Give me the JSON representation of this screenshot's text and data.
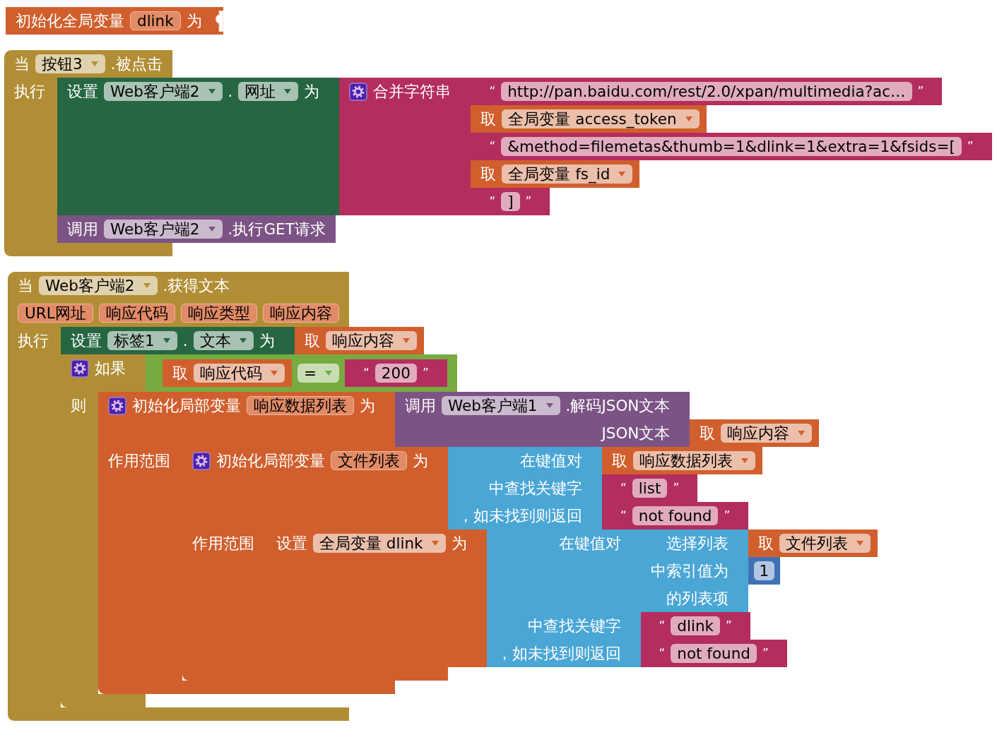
{
  "blocks": [
    {
      "kind": "global_init",
      "inputs": [
        {
          "kind": "value",
          "fields": [
            {
              "kind": "label",
              "text": "初始化全局变量"
            },
            {
              "kind": "name",
              "text": "dlink"
            },
            {
              "kind": "label",
              "text": "为"
            }
          ]
        }
      ]
    },
    {
      "kind": "event",
      "inputs": [
        {
          "kind": "dummy",
          "fields": [
            {
              "kind": "label",
              "text": "当"
            },
            {
              "kind": "dropdown",
              "text": "按钮3"
            },
            {
              "kind": "label",
              "text": ".被点击"
            }
          ]
        },
        {
          "kind": "statement",
          "fields": [
            {
              "kind": "label",
              "text": "执行"
            }
          ],
          "blocks": [
            {
              "kind": "component_setter",
              "inputs": [
                {
                  "kind": "value",
                  "fields": [
                    {
                      "kind": "label",
                      "text": "设置"
                    },
                    {
                      "kind": "dropdown",
                      "text": "Web客户端2"
                    },
                    {
                      "kind": "label",
                      "text": "."
                    },
                    {
                      "kind": "dropdown",
                      "text": "网址"
                    },
                    {
                      "kind": "label",
                      "text": "为"
                    }
                  ],
                  "block": {
                    "kind": "join",
                    "inputs": [
                      {
                        "kind": "value",
                        "fields": [
                          {
                            "kind": "mutator"
                          },
                          {
                            "kind": "label",
                            "text": "合并字符串"
                          }
                        ],
                        "block": {
                          "kind": "text",
                          "inputs": [
                            {
                              "kind": "dummy",
                              "fields": [
                                {
                                  "kind": "quote",
                                  "text": "“"
                                },
                                {
                                  "kind": "text",
                                  "text": "http://pan.baidu.com/rest/2.0/xpan/multimedia?ac…"
                                },
                                {
                                  "kind": "quote",
                                  "text": "”"
                                }
                              ]
                            }
                          ]
                        }
                      },
                      {
                        "kind": "value",
                        "block": {
                          "kind": "getter",
                          "inputs": [
                            {
                              "kind": "dummy",
                              "fields": [
                                {
                                  "kind": "label",
                                  "text": "取"
                                },
                                {
                                  "kind": "dropdown",
                                  "text": "全局变量 access_token"
                                }
                              ]
                            }
                          ]
                        }
                      },
                      {
                        "kind": "value",
                        "block": {
                          "kind": "text",
                          "inputs": [
                            {
                              "kind": "dummy",
                              "fields": [
                                {
                                  "kind": "quote",
                                  "text": "“"
                                },
                                {
                                  "kind": "text",
                                  "text": "&method=filemetas&thumb=1&dlink=1&extra=1&fsids=["
                                },
                                {
                                  "kind": "quote",
                                  "text": "”"
                                }
                              ]
                            }
                          ]
                        }
                      },
                      {
                        "kind": "value",
                        "block": {
                          "kind": "getter",
                          "inputs": [
                            {
                              "kind": "dummy",
                              "fields": [
                                {
                                  "kind": "label",
                                  "text": "取"
                                },
                                {
                                  "kind": "dropdown",
                                  "text": "全局变量 fs_id"
                                }
                              ]
                            }
                          ]
                        }
                      },
                      {
                        "kind": "value",
                        "block": {
                          "kind": "text",
                          "inputs": [
                            {
                              "kind": "dummy",
                              "fields": [
                                {
                                  "kind": "quote",
                                  "text": "“"
                                },
                                {
                                  "kind": "text",
                                  "text": "]"
                                },
                                {
                                  "kind": "quote",
                                  "text": "”"
                                }
                              ]
                            }
                          ]
                        }
                      }
                    ]
                  }
                }
              ]
            },
            {
              "kind": "method_call",
              "inputs": [
                {
                  "kind": "dummy",
                  "fields": [
                    {
                      "kind": "label",
                      "text": "调用"
                    },
                    {
                      "kind": "dropdown",
                      "text": "Web客户端2"
                    },
                    {
                      "kind": "label",
                      "text": ".执行GET请求"
                    }
                  ]
                }
              ]
            }
          ]
        }
      ]
    },
    {
      "kind": "event",
      "inputs": [
        {
          "kind": "dummy",
          "fields": [
            {
              "kind": "label",
              "text": "当"
            },
            {
              "kind": "dropdown",
              "text": "Web客户端2"
            },
            {
              "kind": "label",
              "text": ".获得文本"
            }
          ]
        },
        {
          "kind": "dummy",
          "fields": [
            {
              "kind": "name",
              "text": "URL网址"
            },
            {
              "kind": "name",
              "text": "响应代码"
            },
            {
              "kind": "name",
              "text": "响应类型"
            },
            {
              "kind": "name",
              "text": "响应内容"
            }
          ]
        },
        {
          "kind": "statement",
          "fields": [
            {
              "kind": "label",
              "text": "执行"
            }
          ],
          "blocks": [
            {
              "kind": "component_setter",
              "inputs": [
                {
                  "kind": "value",
                  "fields": [
                    {
                      "kind": "label",
                      "text": "设置"
                    },
                    {
                      "kind": "dropdown",
                      "text": "标签1"
                    },
                    {
                      "kind": "label",
                      "text": "."
                    },
                    {
                      "kind": "dropdown",
                      "text": "文本"
                    },
                    {
                      "kind": "label",
                      "text": "为"
                    }
                  ],
                  "block": {
                    "kind": "getter",
                    "inputs": [
                      {
                        "kind": "dummy",
                        "fields": [
                          {
                            "kind": "label",
                            "text": "取"
                          },
                          {
                            "kind": "dropdown",
                            "text": "响应内容"
                          }
                        ]
                      }
                    ]
                  }
                }
              ]
            },
            {
              "kind": "if",
              "inputs": [
                {
                  "kind": "value",
                  "fields": [
                    {
                      "kind": "mutator"
                    },
                    {
                      "kind": "label",
                      "text": "如果"
                    }
                  ],
                  "block": {
                    "kind": "compare",
                    "inputs": [
                      {
                        "kind": "value",
                        "block": {
                          "kind": "getter",
                          "inputs": [
                            {
                              "kind": "dummy",
                              "fields": [
                                {
                                  "kind": "label",
                                  "text": "取"
                                },
                                {
                                  "kind": "dropdown",
                                  "text": "响应代码"
                                }
                              ]
                            }
                          ]
                        }
                      },
                      {
                        "kind": "value",
                        "fields": [
                          {
                            "kind": "dropdown",
                            "text": "="
                          }
                        ],
                        "block": {
                          "kind": "text",
                          "inputs": [
                            {
                              "kind": "dummy",
                              "fields": [
                                {
                                  "kind": "quote",
                                  "text": "“"
                                },
                                {
                                  "kind": "text",
                                  "text": "200"
                                },
                                {
                                  "kind": "quote",
                                  "text": "”"
                                }
                              ]
                            }
                          ]
                        }
                      }
                    ]
                  }
                },
                {
                  "kind": "statement",
                  "fields": [
                    {
                      "kind": "label",
                      "text": "则"
                    }
                  ],
                  "blocks": [
                    {
                      "kind": "local_init",
                      "inputs": [
                        {
                          "kind": "value",
                          "fields": [
                            {
                              "kind": "mutator"
                            },
                            {
                              "kind": "label",
                              "text": "初始化局部变量"
                            },
                            {
                              "kind": "name",
                              "text": "响应数据列表"
                            },
                            {
                              "kind": "label",
                              "text": "为"
                            }
                          ],
                          "block": {
                            "kind": "method_call",
                            "inputs": [
                              {
                                "kind": "dummy",
                                "fields": [
                                  {
                                    "kind": "label",
                                    "text": "调用"
                                  },
                                  {
                                    "kind": "dropdown",
                                    "text": "Web客户端1"
                                  },
                                  {
                                    "kind": "label",
                                    "text": ".解码JSON文本"
                                  }
                                ]
                              },
                              {
                                "kind": "value",
                                "fields": [
                                  {
                                    "kind": "label",
                                    "text": "JSON文本"
                                  }
                                ],
                                "block": {
                                  "kind": "getter",
                                  "inputs": [
                                    {
                                      "kind": "dummy",
                                      "fields": [
                                        {
                                          "kind": "label",
                                          "text": "取"
                                        },
                                        {
                                          "kind": "dropdown",
                                          "text": "响应内容"
                                        }
                                      ]
                                    }
                                  ]
                                }
                              }
                            ]
                          }
                        },
                        {
                          "kind": "statement",
                          "fields": [
                            {
                              "kind": "label",
                              "text": "作用范围"
                            }
                          ],
                          "blocks": [
                            {
                              "kind": "local_init",
                              "inputs": [
                                {
                                  "kind": "value",
                                  "fields": [
                                    {
                                      "kind": "mutator"
                                    },
                                    {
                                      "kind": "label",
                                      "text": "初始化局部变量"
                                    },
                                    {
                                      "kind": "name",
                                      "text": "文件列表"
                                    },
                                    {
                                      "kind": "label",
                                      "text": "为"
                                    }
                                  ],
                                  "block": {
                                    "kind": "dict_lookup",
                                    "inputs": [
                                      {
                                        "kind": "value",
                                        "fields": [
                                          {
                                            "kind": "label",
                                            "text": "在键值对"
                                          }
                                        ],
                                        "block": {
                                          "kind": "getter",
                                          "inputs": [
                                            {
                                              "kind": "dummy",
                                              "fields": [
                                                {
                                                  "kind": "label",
                                                  "text": "取"
                                                },
                                                {
                                                  "kind": "dropdown",
                                                  "text": "响应数据列表"
                                                }
                                              ]
                                            }
                                          ]
                                        }
                                      },
                                      {
                                        "kind": "value",
                                        "fields": [
                                          {
                                            "kind": "label",
                                            "text": "中查找关键字"
                                          }
                                        ],
                                        "block": {
                                          "kind": "text",
                                          "inputs": [
                                            {
                                              "kind": "dummy",
                                              "fields": [
                                                {
                                                  "kind": "quote",
                                                  "text": "“"
                                                },
                                                {
                                                  "kind": "text",
                                                  "text": "list"
                                                },
                                                {
                                                  "kind": "quote",
                                                  "text": "”"
                                                }
                                              ]
                                            }
                                          ]
                                        }
                                      },
                                      {
                                        "kind": "value",
                                        "fields": [
                                          {
                                            "kind": "label",
                                            "text": "，如未找到则返回"
                                          }
                                        ],
                                        "block": {
                                          "kind": "text",
                                          "inputs": [
                                            {
                                              "kind": "dummy",
                                              "fields": [
                                                {
                                                  "kind": "quote",
                                                  "text": "“"
                                                },
                                                {
                                                  "kind": "text",
                                                  "text": "not found"
                                                },
                                                {
                                                  "kind": "quote",
                                                  "text": "”"
                                                }
                                              ]
                                            }
                                          ]
                                        }
                                      }
                                    ]
                                  }
                                },
                                {
                                  "kind": "statement",
                                  "fields": [
                                    {
                                      "kind": "label",
                                      "text": "作用范围"
                                    }
                                  ],
                                  "blocks": [
                                    {
                                      "kind": "variable_setter",
                                      "inputs": [
                                        {
                                          "kind": "value",
                                          "fields": [
                                            {
                                              "kind": "label",
                                              "text": "设置"
                                            },
                                            {
                                              "kind": "dropdown",
                                              "text": "全局变量 dlink"
                                            },
                                            {
                                              "kind": "label",
                                              "text": "为"
                                            }
                                          ],
                                          "block": {
                                            "kind": "dict_lookup",
                                            "inputs": [
                                              {
                                                "kind": "value",
                                                "fields": [
                                                  {
                                                    "kind": "label",
                                                    "text": "在键值对"
                                                  }
                                                ],
                                                "block": {
                                                  "kind": "list_select",
                                                  "inputs": [
                                                    {
                                                      "kind": "value",
                                                      "fields": [
                                                        {
                                                          "kind": "label",
                                                          "text": "选择列表"
                                                        }
                                                      ],
                                                      "block": {
                                                        "kind": "getter",
                                                        "inputs": [
                                                          {
                                                            "kind": "dummy",
                                                            "fields": [
                                                              {
                                                                "kind": "label",
                                                                "text": "取"
                                                              },
                                                              {
                                                                "kind": "dropdown",
                                                                "text": "文件列表"
                                                              }
                                                            ]
                                                          }
                                                        ]
                                                      }
                                                    },
                                                    {
                                                      "kind": "value",
                                                      "fields": [
                                                        {
                                                          "kind": "label",
                                                          "text": "中索引值为"
                                                        }
                                                      ],
                                                      "block": {
                                                        "kind": "number",
                                                        "inputs": [
                                                          {
                                                            "kind": "dummy",
                                                            "fields": [
                                                              {
                                                                "kind": "number",
                                                                "text": "1"
                                                              }
                                                            ]
                                                          }
                                                        ]
                                                      }
                                                    },
                                                    {
                                                      "kind": "dummy",
                                                      "fields": [
                                                        {
                                                          "kind": "label",
                                                          "text": "的列表项"
                                                        }
                                                      ]
                                                    }
                                                  ]
                                                }
                                              },
                                              {
                                                "kind": "value",
                                                "fields": [
                                                  {
                                                    "kind": "label",
                                                    "text": "中查找关键字"
                                                  }
                                                ],
                                                "block": {
                                                  "kind": "text",
                                                  "inputs": [
                                                    {
                                                      "kind": "dummy",
                                                      "fields": [
                                                        {
                                                          "kind": "quote",
                                                          "text": "“"
                                                        },
                                                        {
                                                          "kind": "text",
                                                          "text": "dlink"
                                                        },
                                                        {
                                                          "kind": "quote",
                                                          "text": "”"
                                                        }
                                                      ]
                                                    }
                                                  ]
                                                }
                                              },
                                              {
                                                "kind": "value",
                                                "fields": [
                                                  {
                                                    "kind": "label",
                                                    "text": "，如未找到则返回"
                                                  }
                                                ],
                                                "block": {
                                                  "kind": "text",
                                                  "inputs": [
                                                    {
                                                      "kind": "dummy",
                                                      "fields": [
                                                        {
                                                          "kind": "quote",
                                                          "text": "“"
                                                        },
                                                        {
                                                          "kind": "text",
                                                          "text": "not found"
                                                        },
                                                        {
                                                          "kind": "quote",
                                                          "text": "”"
                                                        }
                                                      ]
                                                    }
                                                  ]
                                                }
                                              }
                                            ]
                                          }
                                        }
                                      ]
                                    }
                                  ]
                                }
                              ]
                            }
                          ]
                        }
                      ]
                    }
                  ]
                }
              ]
            }
          ]
        }
      ]
    }
  ]
}
